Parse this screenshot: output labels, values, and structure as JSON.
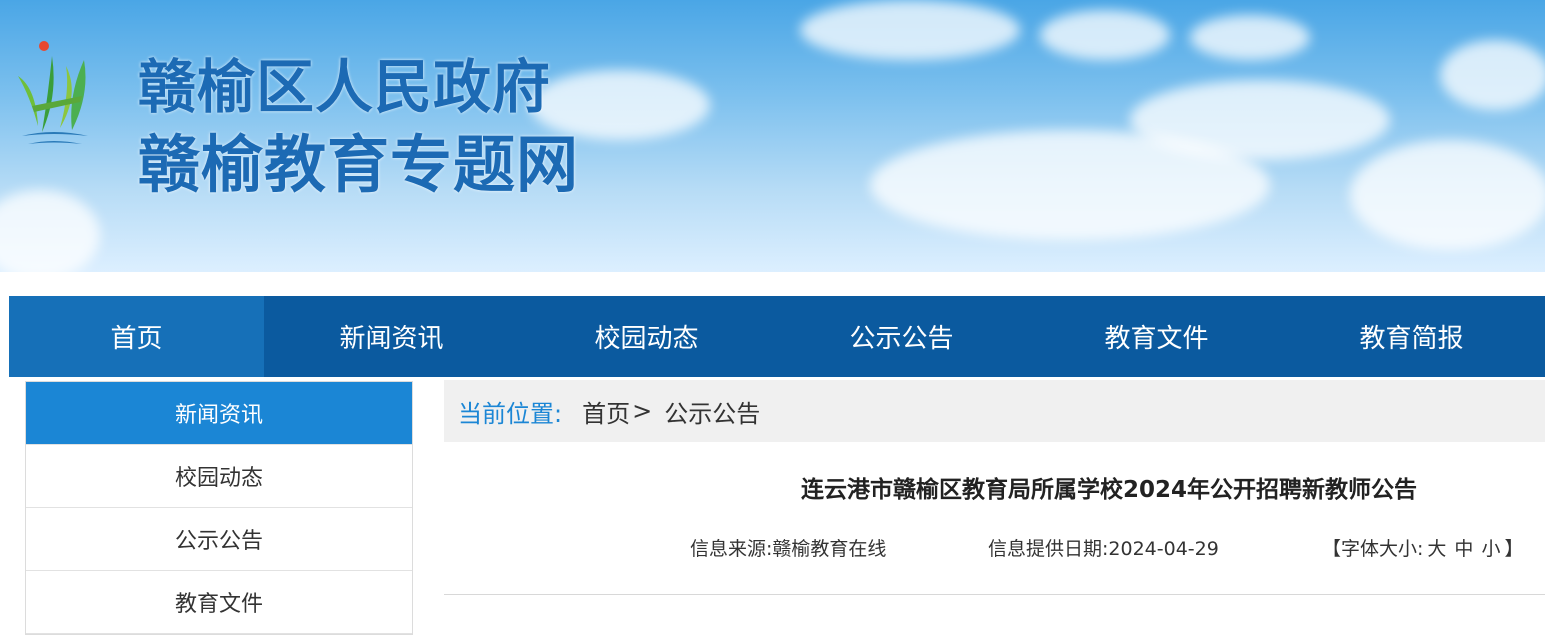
{
  "header": {
    "title_line1": "赣榆区人民政府",
    "title_line2": "赣榆教育专题网",
    "logo_icon": "gov-emblem-logo-icon"
  },
  "nav": {
    "items": [
      {
        "label": "首页",
        "active": true
      },
      {
        "label": "新闻资讯",
        "active": false
      },
      {
        "label": "校园动态",
        "active": false
      },
      {
        "label": "公示公告",
        "active": false
      },
      {
        "label": "教育文件",
        "active": false
      },
      {
        "label": "教育简报",
        "active": false
      }
    ]
  },
  "sidebar": {
    "items": [
      {
        "label": "新闻资讯",
        "active": true
      },
      {
        "label": "校园动态",
        "active": false
      },
      {
        "label": "公示公告",
        "active": false
      },
      {
        "label": "教育文件",
        "active": false
      }
    ]
  },
  "breadcrumb": {
    "label": "当前位置:",
    "home": "首页",
    "separator": ">",
    "current": "公示公告"
  },
  "article": {
    "title": "连云港市赣榆区教育局所属学校2024年公开招聘新教师公告",
    "source": "信息来源:赣榆教育在线",
    "date": "信息提供日期:2024-04-29",
    "font_size_prefix": "【字体大小:",
    "font_large": "大",
    "font_medium": "中",
    "font_small": "小",
    "font_size_suffix": "】"
  },
  "colors": {
    "nav_bg": "#0b5a9f",
    "nav_active": "#1670b8",
    "sidebar_active": "#1b86d5",
    "title_blue": "#1c6ab4"
  }
}
